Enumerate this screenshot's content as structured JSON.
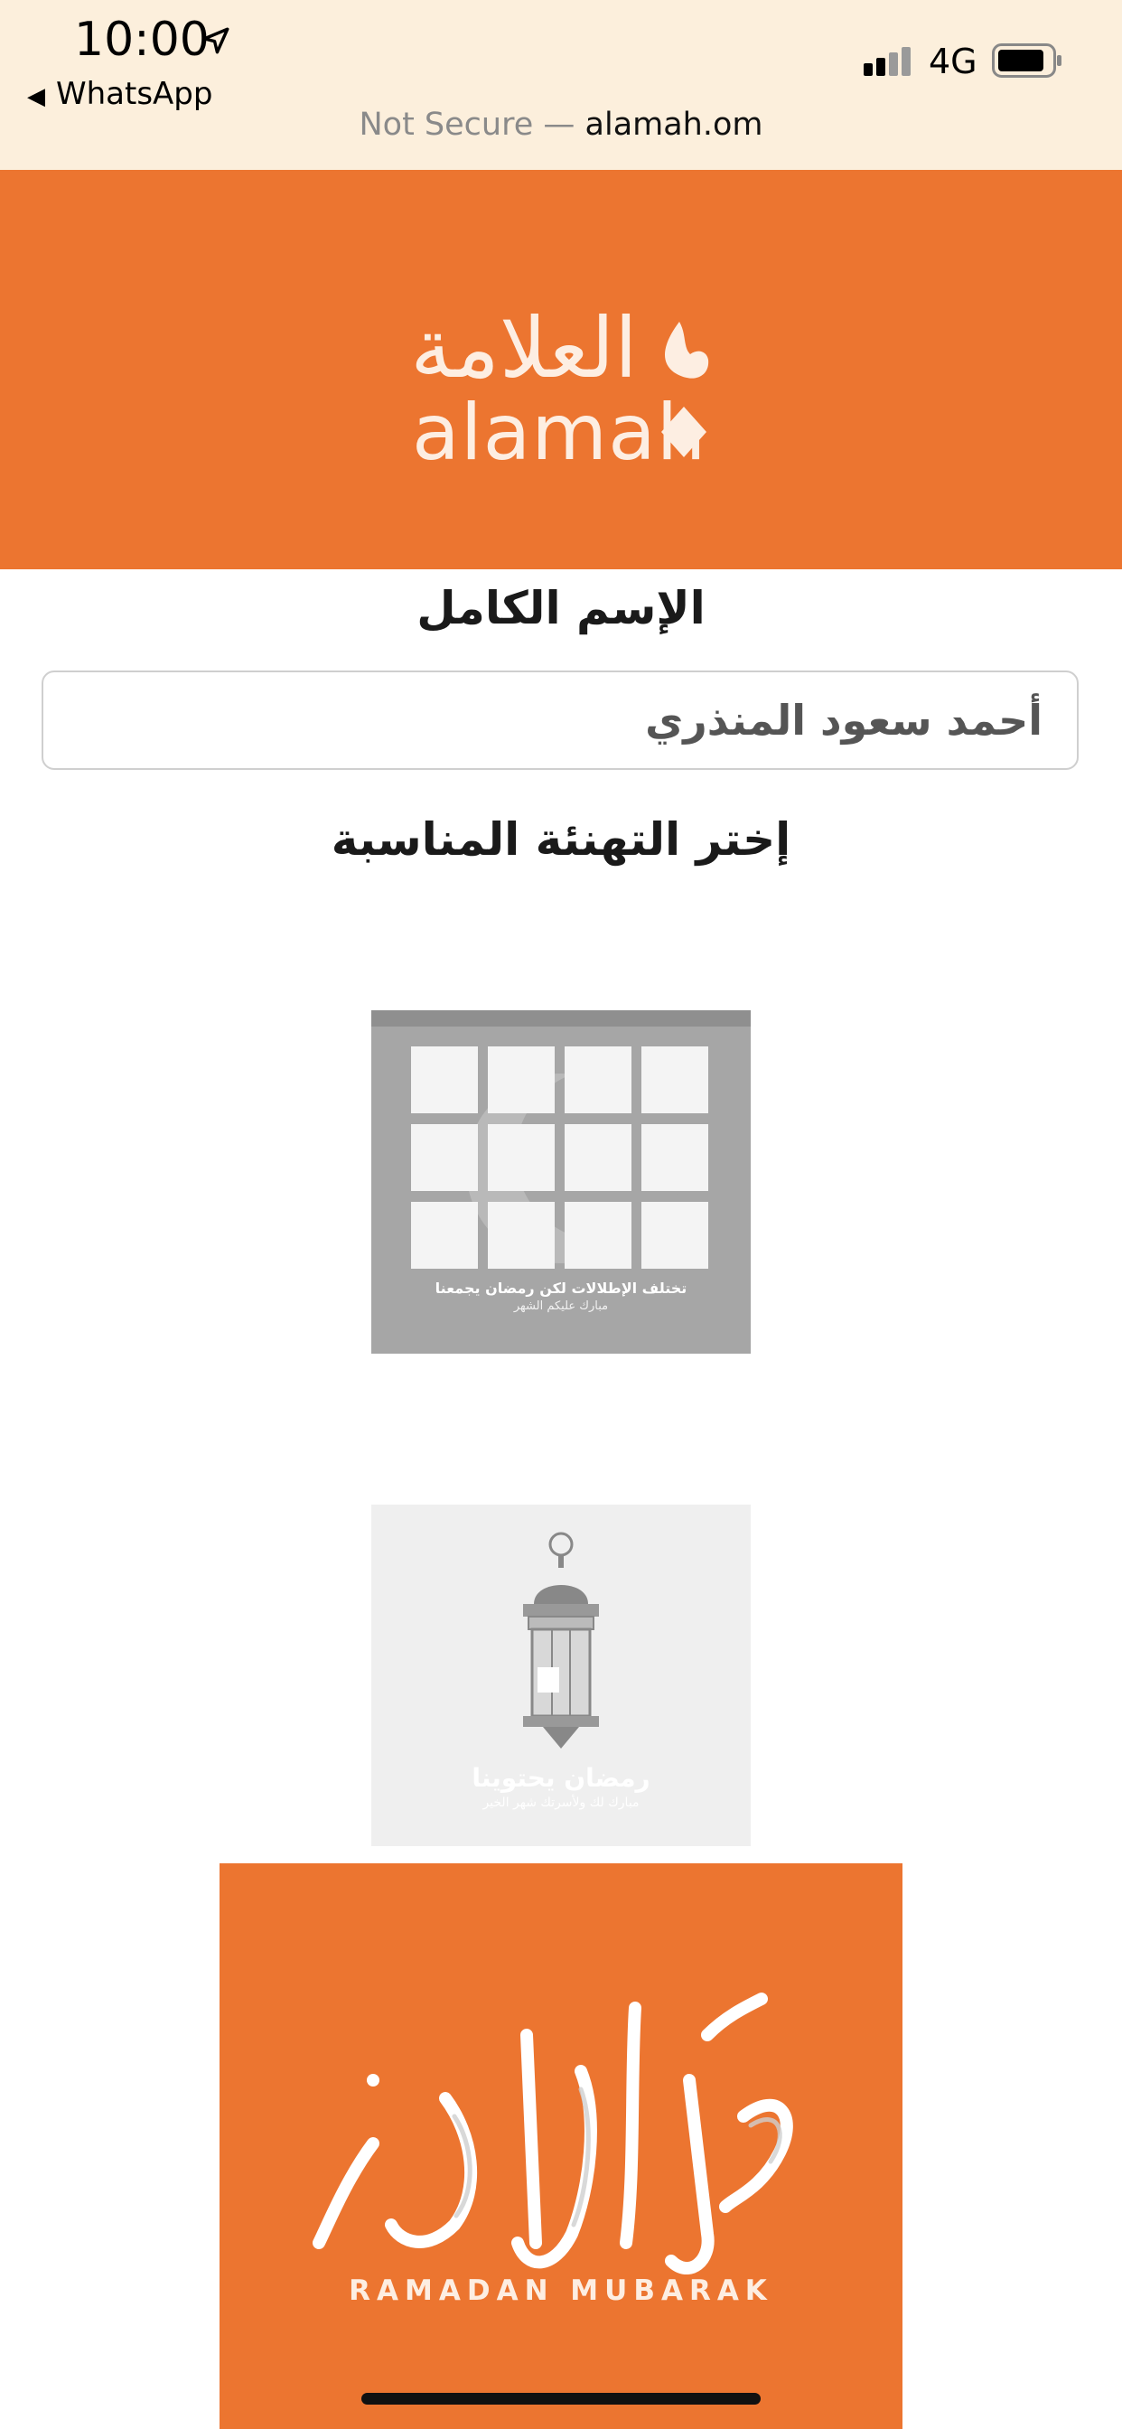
{
  "status_bar": {
    "time": "10:00",
    "back_app": "WhatsApp",
    "network": "4G",
    "url_prefix": "Not Secure — ",
    "url_domain": "alamah.om",
    "icons": [
      "location-arrow-icon",
      "signal-icon",
      "battery-icon"
    ]
  },
  "header": {
    "logo_arabic": "العلامة",
    "logo_english": "alamah",
    "color": "#ec7530"
  },
  "form": {
    "name_label": "الإسم الكامل",
    "name_value": "أحمد سعود المنذري",
    "choose_label": "إختر التهنئة المناسبة"
  },
  "cards": [
    {
      "line1": "تختلف الإطلالات لكن رمضان يجمعنا",
      "line2": "مبارك عليكم الشهر"
    },
    {
      "line1": "رمضان يحتوينا",
      "line2": "مبارك لك ولأسرتك شهر الخير"
    },
    {
      "caption": "RAMADAN MUBARAK"
    }
  ]
}
